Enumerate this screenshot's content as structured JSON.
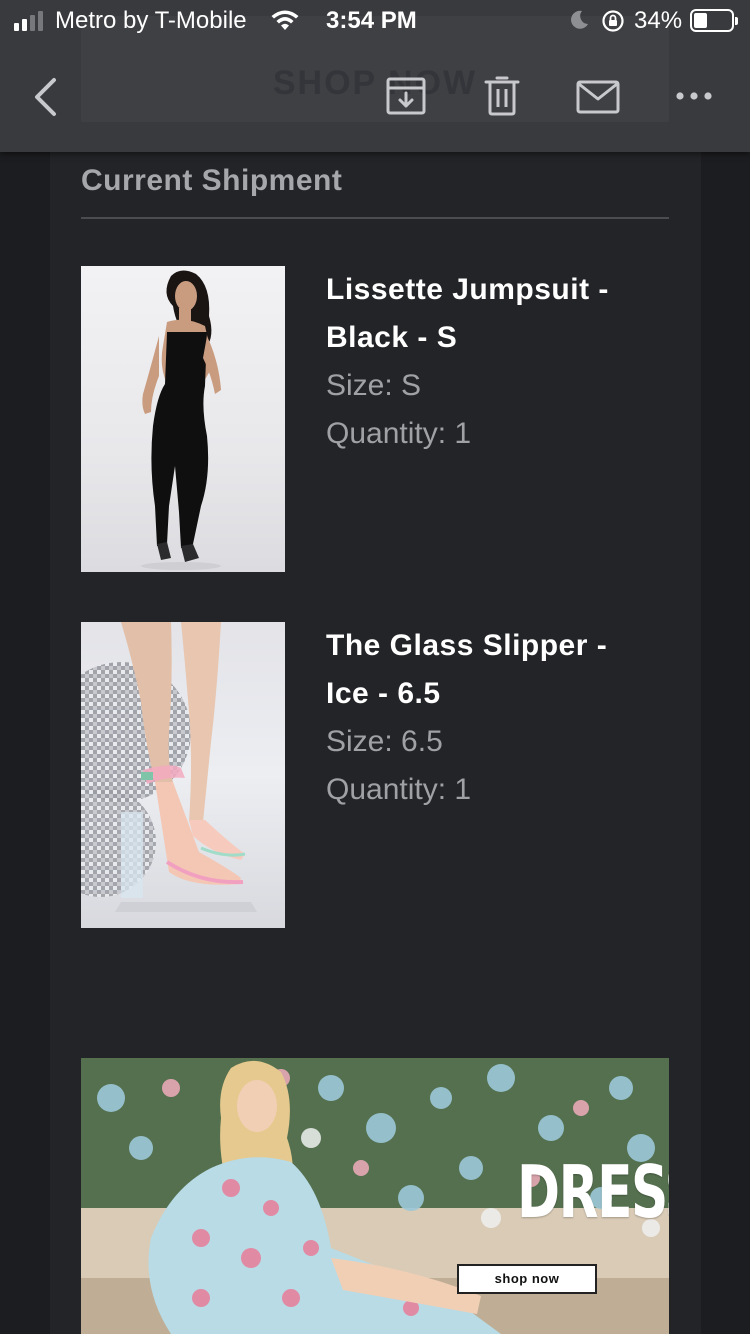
{
  "status_bar": {
    "carrier": "Metro by T-Mobile",
    "time": "3:54 PM",
    "battery_percent": "34%",
    "battery_level": 0.34,
    "signal_bars": 2
  },
  "toolbar": {
    "ghost_button_label": "SHOP NOW",
    "icons": [
      "back-chevron-icon",
      "archive-icon",
      "trash-icon",
      "mail-icon",
      "more-icon"
    ]
  },
  "shipment": {
    "title": "Current Shipment",
    "items": [
      {
        "name": "Lissette Jumpsuit - Black - S",
        "size_label": "Size:",
        "size": "S",
        "quantity_label": "Quantity:",
        "quantity": "1",
        "image": "black-jumpsuit-photo"
      },
      {
        "name": "The Glass Slipper - Ice - 6.5",
        "size_label": "Size:",
        "size": "6.5",
        "quantity_label": "Quantity:",
        "quantity": "1",
        "image": "clear-heels-photo"
      }
    ]
  },
  "banner": {
    "title": "DRESSES",
    "button_label": "shop now",
    "image": "floral-dress-photo"
  },
  "colors": {
    "background": "#1c1d20",
    "card": "#232427",
    "navbar": "#3a3b3f",
    "muted_text": "#a0a1a5",
    "title_text": "#a6a7ab"
  }
}
